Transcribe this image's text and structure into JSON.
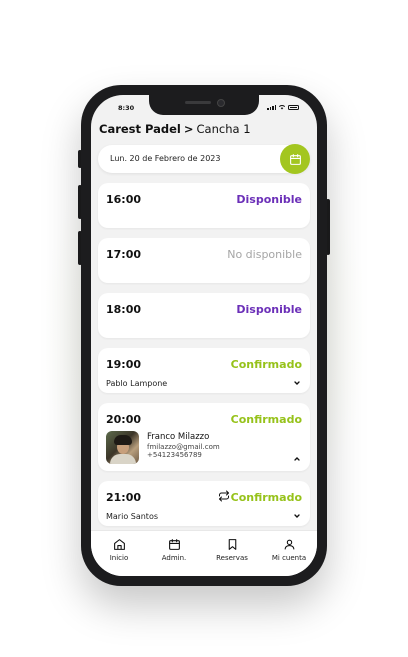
{
  "status_bar": {
    "time": "8:30"
  },
  "header": {
    "club": "Carest Padel",
    "separator": ">",
    "court": "Cancha 1"
  },
  "date_bar": {
    "date_text": "Lun. 20 de Febrero de 2023",
    "icon": "calendar-icon"
  },
  "slots": [
    {
      "time": "16:00",
      "status": "Disponible"
    },
    {
      "time": "17:00",
      "status": "No disponible"
    },
    {
      "time": "18:00",
      "status": "Disponible"
    },
    {
      "time": "19:00",
      "status": "Confirmado",
      "name": "Pablo Lampone"
    },
    {
      "time": "20:00",
      "status": "Confirmado",
      "name": "Franco Milazzo",
      "email": "fmilazzo@gmail.com",
      "phone": "+54123456789"
    },
    {
      "time": "21:00",
      "status": "Confirmado",
      "name": "Mario Santos",
      "icon": "repeat-icon"
    }
  ],
  "nav": [
    {
      "label": "Inicio",
      "icon": "home-icon"
    },
    {
      "label": "Admin.",
      "icon": "calendar-icon"
    },
    {
      "label": "Reservas",
      "icon": "bookmark-icon"
    },
    {
      "label": "Mi cuenta",
      "icon": "user-icon"
    }
  ],
  "colors": {
    "accent": "#a3c61f",
    "available": "#6b2fb8",
    "confirmed": "#96c21a",
    "unavailable": "#a5a5a5"
  }
}
